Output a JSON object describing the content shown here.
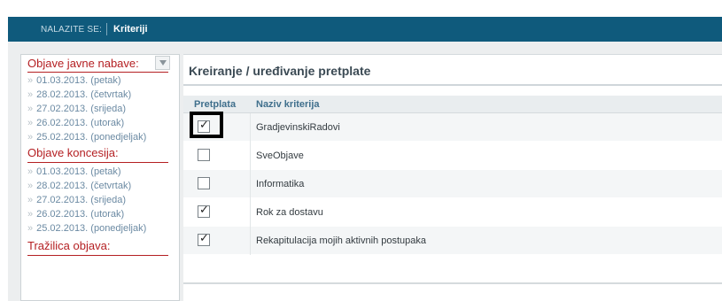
{
  "header": {
    "crumb_label": "NALAZITE SE:",
    "crumb_value": "Kriteriji"
  },
  "sidebar": {
    "sections": [
      {
        "title": "Objave javne nabave:",
        "items": [
          "01.03.2013. (petak)",
          "28.02.2013. (četvrtak)",
          "27.02.2013. (srijeda)",
          "26.02.2013. (utorak)",
          "25.02.2013. (ponedjeljak)"
        ]
      },
      {
        "title": "Objave koncesija:",
        "items": [
          "01.03.2013. (petak)",
          "28.02.2013. (četvrtak)",
          "27.02.2013. (srijeda)",
          "26.02.2013. (utorak)",
          "25.02.2013. (ponedjeljak)"
        ]
      },
      {
        "title": "Tražilica objava:",
        "items": []
      }
    ],
    "filter_icon": "filter-dropdown-icon",
    "bullet": "»"
  },
  "main": {
    "title": "Kreiranje / uređivanje pretplate",
    "columns": [
      "Pretplata",
      "Naziv kriterija"
    ],
    "rows": [
      {
        "checked": true,
        "name": "GradjevinskiRadovi"
      },
      {
        "checked": false,
        "name": "SveObjave"
      },
      {
        "checked": false,
        "name": "Informatika"
      },
      {
        "checked": true,
        "name": "Rok za dostavu"
      },
      {
        "checked": true,
        "name": "Rekapitulacija mojih aktivnih postupaka"
      }
    ]
  },
  "colors": {
    "header_bg": "#0f5a7c",
    "accent_red": "#b41f22",
    "link_blue": "#6b8aa3"
  }
}
